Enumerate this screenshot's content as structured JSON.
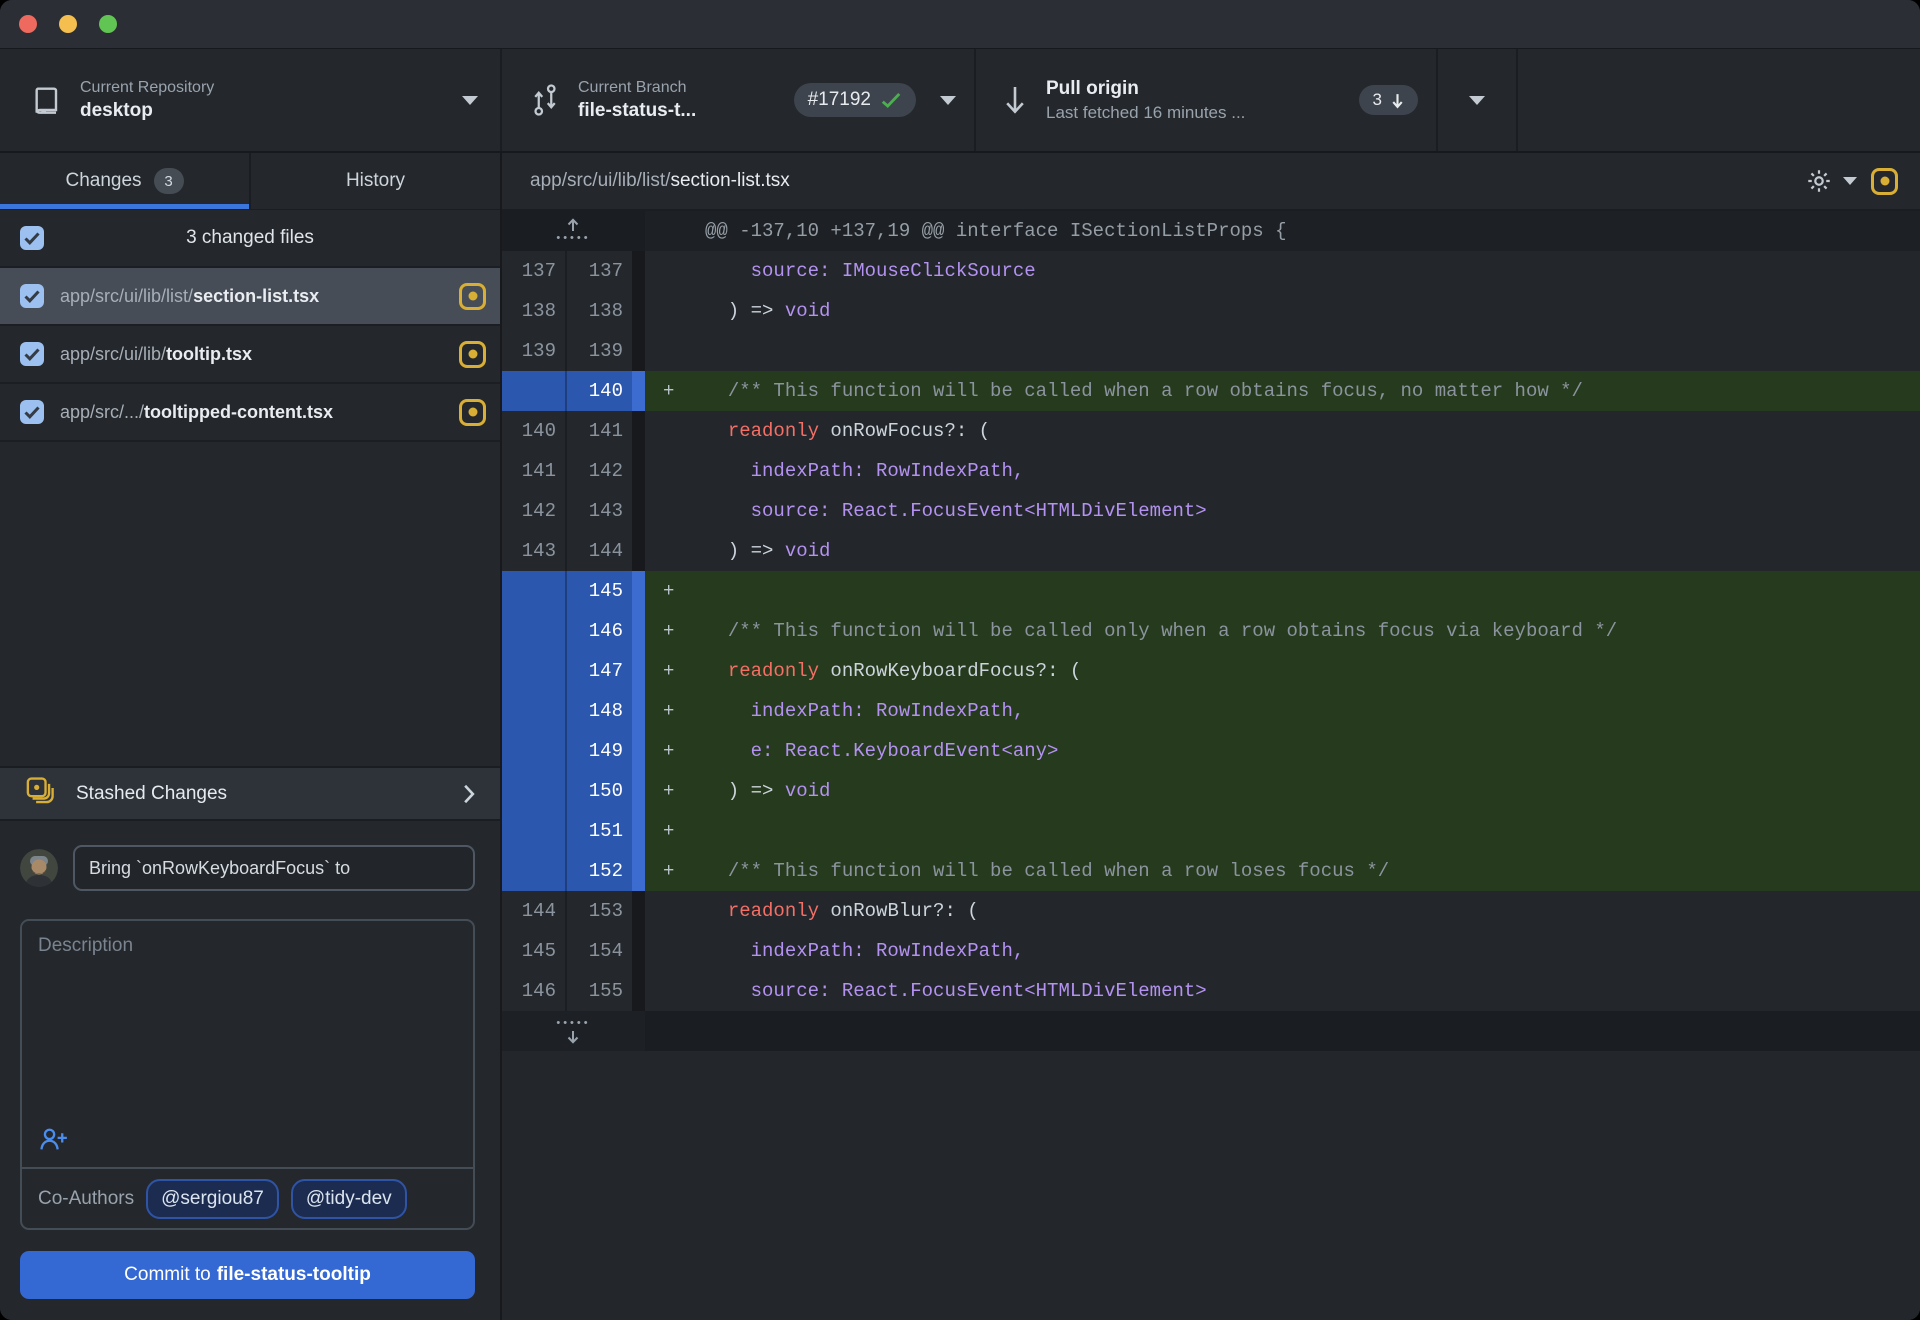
{
  "window": {
    "traffic_lights": [
      "#ee6a5f",
      "#f5bf4f",
      "#61c554"
    ]
  },
  "toolbar": {
    "repo": {
      "label": "Current Repository",
      "value": "desktop"
    },
    "branch": {
      "label": "Current Branch",
      "value": "file-status-t...",
      "badge": "#17192"
    },
    "pull": {
      "title": "Pull origin",
      "subtitle": "Last fetched 16 minutes ...",
      "badge_count": "3"
    }
  },
  "sidebar": {
    "tabs": [
      {
        "label": "Changes",
        "badge": "3",
        "active": true
      },
      {
        "label": "History",
        "active": false
      }
    ],
    "files_header": "3 changed files",
    "files": [
      {
        "dir": "app/src/ui/lib/list/",
        "name": "section-list.tsx",
        "selected": true,
        "status": "modified",
        "checked": true
      },
      {
        "dir": "app/src/ui/lib/",
        "name": "tooltip.tsx",
        "selected": false,
        "status": "modified",
        "checked": true
      },
      {
        "dir": "app/src/.../",
        "name": "tooltipped-content.tsx",
        "selected": false,
        "status": "modified",
        "checked": true
      }
    ],
    "stashed_label": "Stashed Changes",
    "commit": {
      "summary_value": "Bring `onRowKeyboardFocus` to",
      "description_placeholder": "Description",
      "coauthors_label": "Co-Authors",
      "coauthors": [
        "@sergiou87",
        "@tidy-dev"
      ],
      "button_prefix": "Commit to ",
      "button_branch": "file-status-tooltip"
    }
  },
  "diff": {
    "file_dir": "app/src/ui/lib/list/",
    "file_name": "section-list.tsx",
    "rows": [
      {
        "t": "hunk",
        "text": "@@ -137,10 +137,19 @@ interface ISectionListProps {"
      },
      {
        "t": "ctx",
        "o": "137",
        "n": "137",
        "s": [
          [
            "    source: IMouseClickSource",
            "pu"
          ]
        ]
      },
      {
        "t": "ctx",
        "o": "138",
        "n": "138",
        "s": [
          [
            "  ) => ",
            "wh"
          ],
          [
            "void",
            "pu"
          ]
        ]
      },
      {
        "t": "ctx",
        "o": "139",
        "n": "139",
        "s": []
      },
      {
        "t": "add",
        "n": "140",
        "s": [
          [
            "  ",
            "wh"
          ],
          [
            "/** This function will be called when a row obtains focus, no matter how */",
            "cm"
          ]
        ]
      },
      {
        "t": "ctx",
        "o": "140",
        "n": "141",
        "s": [
          [
            "  ",
            "wh"
          ],
          [
            "readonly",
            "kw"
          ],
          [
            " onRowFocus?: (",
            "wh"
          ]
        ]
      },
      {
        "t": "ctx",
        "o": "141",
        "n": "142",
        "s": [
          [
            "    indexPath: RowIndexPath,",
            "pu"
          ]
        ]
      },
      {
        "t": "ctx",
        "o": "142",
        "n": "143",
        "s": [
          [
            "    source: React.FocusEvent<HTMLDivElement>",
            "pu"
          ]
        ]
      },
      {
        "t": "ctx",
        "o": "143",
        "n": "144",
        "s": [
          [
            "  ) => ",
            "wh"
          ],
          [
            "void",
            "pu"
          ]
        ]
      },
      {
        "t": "add",
        "n": "145",
        "s": []
      },
      {
        "t": "add",
        "n": "146",
        "s": [
          [
            "  ",
            "wh"
          ],
          [
            "/** This function will be called only when a row obtains focus via keyboard */",
            "cm"
          ]
        ]
      },
      {
        "t": "add",
        "n": "147",
        "s": [
          [
            "  ",
            "wh"
          ],
          [
            "readonly",
            "kw"
          ],
          [
            " onRowKeyboardFocus?: (",
            "wh"
          ]
        ]
      },
      {
        "t": "add",
        "n": "148",
        "s": [
          [
            "    indexPath: RowIndexPath,",
            "pu"
          ]
        ]
      },
      {
        "t": "add",
        "n": "149",
        "s": [
          [
            "    e: React.KeyboardEvent<any>",
            "pu"
          ]
        ]
      },
      {
        "t": "add",
        "n": "150",
        "s": [
          [
            "  ) => ",
            "wh"
          ],
          [
            "void",
            "pu"
          ]
        ]
      },
      {
        "t": "add",
        "n": "151",
        "s": []
      },
      {
        "t": "add",
        "n": "152",
        "s": [
          [
            "  ",
            "wh"
          ],
          [
            "/** This function will be called when a row loses focus */",
            "cm"
          ]
        ]
      },
      {
        "t": "ctx",
        "o": "144",
        "n": "153",
        "s": [
          [
            "  ",
            "wh"
          ],
          [
            "readonly",
            "kw"
          ],
          [
            " onRowBlur?: (",
            "wh"
          ]
        ]
      },
      {
        "t": "ctx",
        "o": "145",
        "n": "154",
        "s": [
          [
            "    indexPath: RowIndexPath,",
            "pu"
          ]
        ]
      },
      {
        "t": "ctx",
        "o": "146",
        "n": "155",
        "s": [
          [
            "    source: React.FocusEvent<HTMLDivElement>",
            "pu"
          ]
        ]
      },
      {
        "t": "expand"
      }
    ]
  },
  "colors": {
    "accent_blue": "#3468d3",
    "tab_underline": "#3b76dd",
    "modified_yellow": "#d8ae35",
    "added_line_bg": "#263a1d",
    "added_gutter_bg": "#2b57ae",
    "keyword_red": "#f47067",
    "identifier_purple": "#b392f0",
    "comment_gray": "#8b949e",
    "check_green": "#4cae4f"
  }
}
